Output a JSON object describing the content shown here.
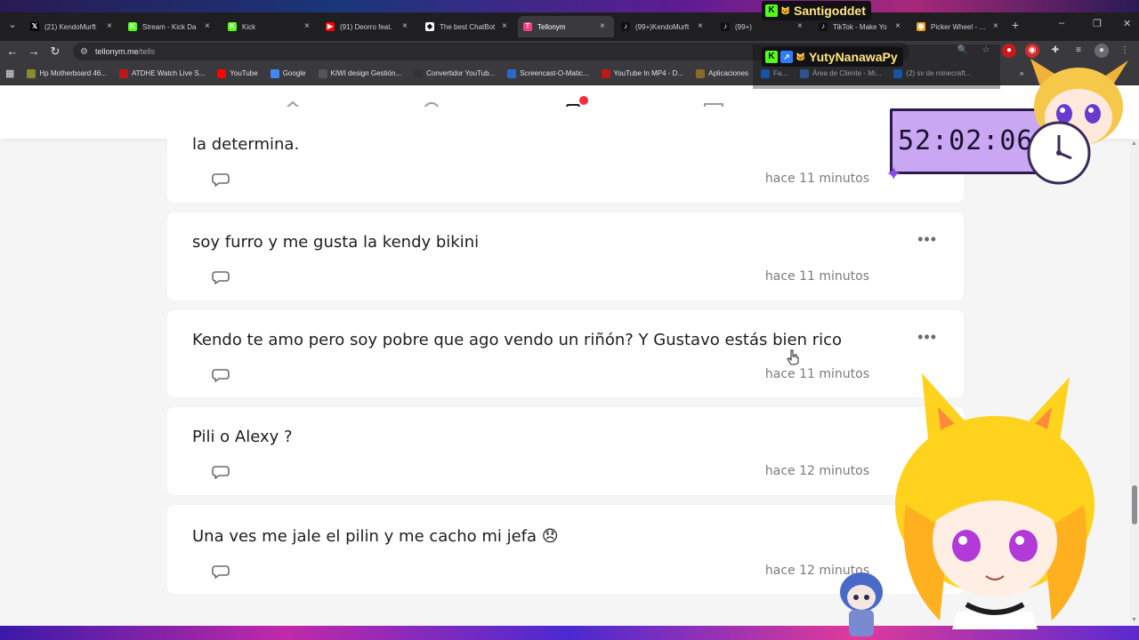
{
  "browser": {
    "tabs": [
      {
        "title": "(21) KendoMurft",
        "favicon": "x-icon",
        "color": "#000000",
        "glyph": "𝕏"
      },
      {
        "title": "Stream - Kick Da",
        "favicon": "kick-icon",
        "color": "#53fc18",
        "glyph": "K"
      },
      {
        "title": "Kick",
        "favicon": "kick-icon",
        "color": "#53fc18",
        "glyph": "K"
      },
      {
        "title": "(91) Deorro feat.",
        "favicon": "youtube-icon",
        "color": "#ff0000",
        "glyph": "▶"
      },
      {
        "title": "The best ChatBot",
        "favicon": "chatbot-icon",
        "color": "#ffffff",
        "glyph": "◆"
      },
      {
        "title": "Tellonym",
        "favicon": "tellonym-icon",
        "color": "#ff3b7a",
        "glyph": "T"
      },
      {
        "title": "(99+)KendoMurft",
        "favicon": "tiktok-icon",
        "color": "#111111",
        "glyph": "♪"
      },
      {
        "title": "(99+)",
        "favicon": "tiktok-icon",
        "color": "#111111",
        "glyph": "♪"
      },
      {
        "title": "TikTok - Make Yo",
        "favicon": "tiktok-icon",
        "color": "#111111",
        "glyph": "♪"
      },
      {
        "title": "Picker Wheel - Sp",
        "favicon": "wheel-icon",
        "color": "#f0a020",
        "glyph": "◉"
      }
    ],
    "active_tab_index": 5,
    "url_host": "tellonym.me",
    "url_path": "/tells",
    "bookmarks": [
      {
        "label": "Hp Motherboard 46...",
        "color": "#8a8a2a"
      },
      {
        "label": "ATDHE Watch Live S...",
        "color": "#c01818"
      },
      {
        "label": "YouTube",
        "color": "#ff0000"
      },
      {
        "label": "Google",
        "color": "#4285f4"
      },
      {
        "label": "KIWI design Gestión...",
        "color": "#555555"
      },
      {
        "label": "Convertidor YouTub...",
        "color": "#333333"
      },
      {
        "label": "Screencast-O-Matic...",
        "color": "#2a6ad0"
      },
      {
        "label": "YouTube In MP4 - D...",
        "color": "#c01818"
      },
      {
        "label": "Aplicaciones",
        "color": "#8a6a2a"
      },
      {
        "label": "Fa...",
        "color": "#1877f2"
      },
      {
        "label": "Área de Cliente - Mi...",
        "color": "#3a7ad0"
      },
      {
        "label": "(2) sv de minecraft...",
        "color": "#1877f2"
      }
    ],
    "bookmarks_overflow": "»"
  },
  "app": {
    "avatar_initial": "K"
  },
  "tells": [
    {
      "text": "la determina.",
      "time": "hace 11 minutos",
      "has_menu": false
    },
    {
      "text": "soy furro y me gusta la kendy bikini",
      "time": "hace 11 minutos",
      "has_menu": true
    },
    {
      "text": "Kendo te amo pero soy pobre que ago vendo un riñón? Y Gustavo estás bien rico",
      "time": "hace 11 minutos",
      "has_menu": true
    },
    {
      "text": "Pili o Alexy ?",
      "time": "hace 12 minutos",
      "has_menu": false
    },
    {
      "text": "Una ves me jale el pilin y me cacho mi jefa 😞",
      "time": "hace 12 minutos",
      "has_menu": false
    }
  ],
  "overlay": {
    "chatters": [
      "Santigoddet",
      "YutyNanawaPy"
    ],
    "timer": "52:02:06"
  },
  "colors": {
    "accent_red": "#ff2a3a",
    "timer_bg": "#c9a7f2",
    "chatter_name": "#ffe680"
  }
}
